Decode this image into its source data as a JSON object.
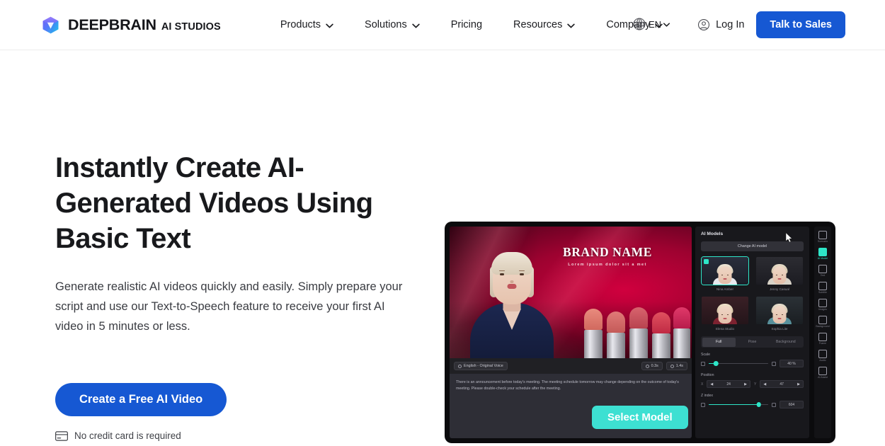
{
  "header": {
    "brand": {
      "name": "DEEPBRAIN",
      "sub": "AI STUDIOS",
      "icon": "cube-logo-icon"
    },
    "nav": [
      {
        "label": "Products",
        "has_dropdown": true
      },
      {
        "label": "Solutions",
        "has_dropdown": true
      },
      {
        "label": "Pricing",
        "has_dropdown": false
      },
      {
        "label": "Resources",
        "has_dropdown": true
      },
      {
        "label": "Company",
        "has_dropdown": true
      }
    ],
    "language": {
      "label": "EN",
      "icon": "globe-icon"
    },
    "login": {
      "label": "Log In",
      "icon": "user-circle-icon"
    },
    "cta": {
      "label": "Talk to Sales",
      "color": "#1658d3"
    }
  },
  "hero": {
    "headline": "Instantly Create AI-Generated Videos Using Basic Text",
    "subhead": "Generate realistic AI videos quickly and easily. Simply prepare your script and use our Text-to-Speech feature to receive your first AI video in 5 minutes or less.",
    "cta_label": "Create a Free AI Video",
    "note": "No credit card is required",
    "note_icon": "credit-card-icon"
  },
  "mockup": {
    "canvas": {
      "brand_title": "BRAND NAME",
      "brand_sub": "Lorem ipsum dolor sit a met"
    },
    "toolbar": {
      "voice_pill": "English - Original Voice",
      "duration_pill": "0.3s",
      "length_pill": "1.4s"
    },
    "script": "There is an announcement before today's meeting. The meeting schedule tomorrow may change depending on the outcome of today's meeting. Please double-check your schedule after the meeting.",
    "panel": {
      "title": "AI Models",
      "change_button": "Change AI model",
      "models": [
        {
          "name": "Nina Amber",
          "selected": true
        },
        {
          "name": "Jenny Casual",
          "selected": false
        },
        {
          "name": "Elena Studio",
          "selected": false
        },
        {
          "name": "Sophia Lite",
          "selected": false
        }
      ],
      "tabs": [
        {
          "label": "Full",
          "active": true
        },
        {
          "label": "Pose",
          "active": false
        },
        {
          "label": "Background",
          "active": false
        }
      ],
      "controls": [
        {
          "label": "Scale",
          "value": "40 %",
          "fill_percent": 12
        },
        {
          "label": "Position",
          "x_label": "X",
          "x_value": "24",
          "y_label": "Y",
          "y_value": "47"
        },
        {
          "label": "Z index",
          "value": "604",
          "fill_percent": 84
        }
      ]
    },
    "rail": [
      {
        "label": "Scenario",
        "icon": "scenes-icon",
        "active": false
      },
      {
        "label": "AI Model",
        "icon": "avatar-icon",
        "active": true
      },
      {
        "label": "Text",
        "icon": "text-icon",
        "active": false
      },
      {
        "label": "Subtitle",
        "icon": "subtitle-icon",
        "active": false
      },
      {
        "label": "Images",
        "icon": "image-icon",
        "active": false
      },
      {
        "label": "Background",
        "icon": "background-icon",
        "active": false
      },
      {
        "label": "Frame",
        "icon": "frame-icon",
        "active": false
      },
      {
        "label": "Audio",
        "icon": "audio-icon",
        "active": false
      },
      {
        "label": "AI Assist",
        "icon": "ai-assist-icon",
        "active": false
      }
    ],
    "select_model_tooltip": "Select Model",
    "accent": "#2ee6c8"
  }
}
